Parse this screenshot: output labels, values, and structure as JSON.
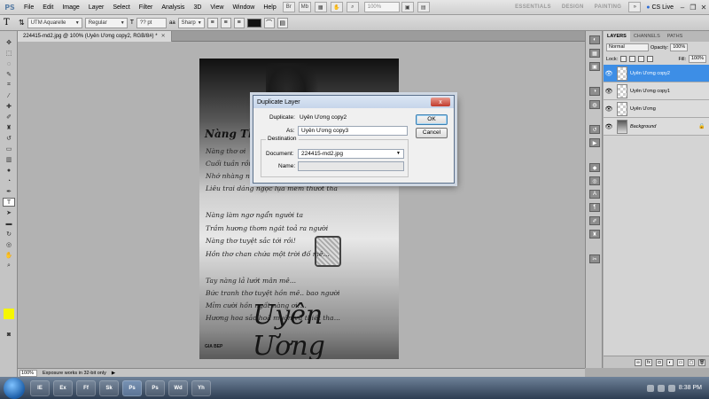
{
  "app": {
    "logo": "PS",
    "menu": [
      "File",
      "Edit",
      "Image",
      "Layer",
      "Select",
      "Filter",
      "Analysis",
      "3D",
      "View",
      "Window",
      "Help"
    ],
    "zoom": "100%",
    "workspaces": [
      "ESSENTIALS",
      "DESIGN",
      "PAINTING"
    ],
    "more_workspaces": "»",
    "cs_live": "CS Live"
  },
  "options": {
    "tool_glyph": "T",
    "font_family": "UTM Aquarelle",
    "font_style": "Regular",
    "font_size": "?? pt",
    "anti_alias": "Sharp",
    "text_color": "#111111"
  },
  "document": {
    "tab_title": "224415-md2.jpg @ 100% (Uyên Ương copy2, RGB/8#) *",
    "zoom": "100%",
    "status": "Exposure works in 32-bit only"
  },
  "image": {
    "title": "Nàng Thơ",
    "poem_lines": [
      "Nàng thơ ơi",
      "Cuối tuần rồi",
      "Nhớ nhàng n",
      "Liêu trai dáng ngọc lụa mềm thướt tha",
      "",
      "Nàng làm ngơ ngẩn người ta",
      "Trầm hương thơm ngát toả ra người",
      "Nàng thơ tuyệt sắc tới rồi!",
      "Hồn thơ chan chứa một trời đố mê...",
      "",
      "Tay nàng lả lướt mân mê...",
      "Bức tranh thơ tuyệt hồn mê.. bao người",
      "Mỉm cười hồn ngất nàng ơi!...",
      "Hương hoa sắc hoà muôn vũ thiết tha..."
    ],
    "signature": "Uyên Ương",
    "watermark": "GIA BEP"
  },
  "dialog": {
    "title": "Duplicate Layer",
    "close_glyph": "x",
    "duplicate_label": "Duplicate:",
    "duplicate_value": "Uyên Ương copy2",
    "as_label": "As:",
    "as_value": "Uyên Ương copy3",
    "destination_label": "Destination",
    "document_label": "Document:",
    "document_value": "224415-md2.jpg",
    "name_label": "Name:",
    "name_value": "",
    "ok_label": "OK",
    "cancel_label": "Cancel"
  },
  "layers_panel": {
    "tabs": [
      "LAYERS",
      "CHANNELS",
      "PATHS"
    ],
    "blend_mode": "Normal",
    "opacity_label": "Opacity:",
    "opacity_value": "100%",
    "lock_label": "Lock:",
    "fill_label": "Fill:",
    "fill_value": "100%",
    "layers": [
      {
        "name": "Uyên Ương copy2",
        "selected": true
      },
      {
        "name": "Uyên Ương copy1",
        "selected": false
      },
      {
        "name": "Uyên Ương",
        "selected": false
      },
      {
        "name": "Background",
        "selected": false
      }
    ]
  },
  "taskbar": {
    "tasks": [
      "IE",
      "Ex",
      "Ff",
      "Sk",
      "Ps",
      "Ps",
      "Wd",
      "Yh"
    ],
    "clock": "8:38 PM"
  }
}
